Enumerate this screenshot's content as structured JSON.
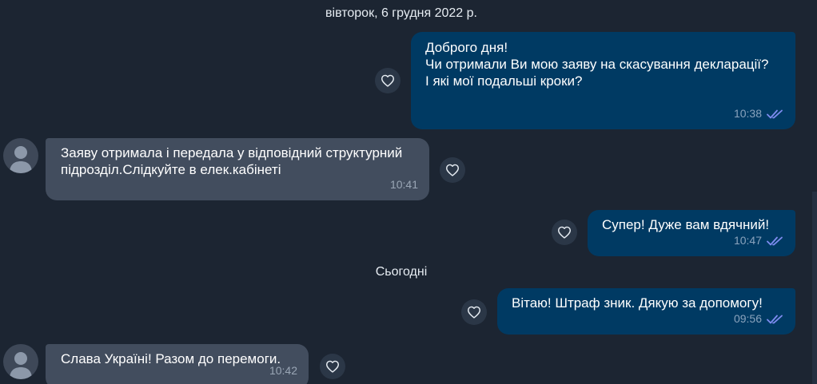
{
  "date_separators": {
    "first": "вівторок, 6 грудня 2022 р.",
    "today": "Сьогодні"
  },
  "messages": [
    {
      "direction": "outgoing",
      "text": "Доброго дня!\nЧи отримали Ви мою заяву на скасування декларації?\nІ які мої подальші кроки?",
      "time": "10:38",
      "status": "read"
    },
    {
      "direction": "incoming",
      "text": "Заяву отримала і передала у відповідний структурний підрозділ.Слідкуйте в елек.кабінеті",
      "time": "10:41"
    },
    {
      "direction": "outgoing",
      "text": "Супер! Дуже вам вдячний!",
      "time": "10:47",
      "status": "read"
    },
    {
      "direction": "outgoing",
      "text": "Вітаю! Штраф зник. Дякую за допомогу!",
      "time": "09:56",
      "status": "read"
    },
    {
      "direction": "incoming",
      "text": "Слава Україні! Разом до перемоги.",
      "time": "10:42"
    }
  ],
  "icons": {
    "reaction": "heart-outline-icon",
    "read_status": "double-check-icon",
    "avatar": "user-avatar-icon"
  },
  "colors": {
    "background": "#1c2532",
    "outgoing_bubble": "#003a63",
    "incoming_bubble": "#424d5e",
    "read_ticks": "#7e8cf0"
  }
}
